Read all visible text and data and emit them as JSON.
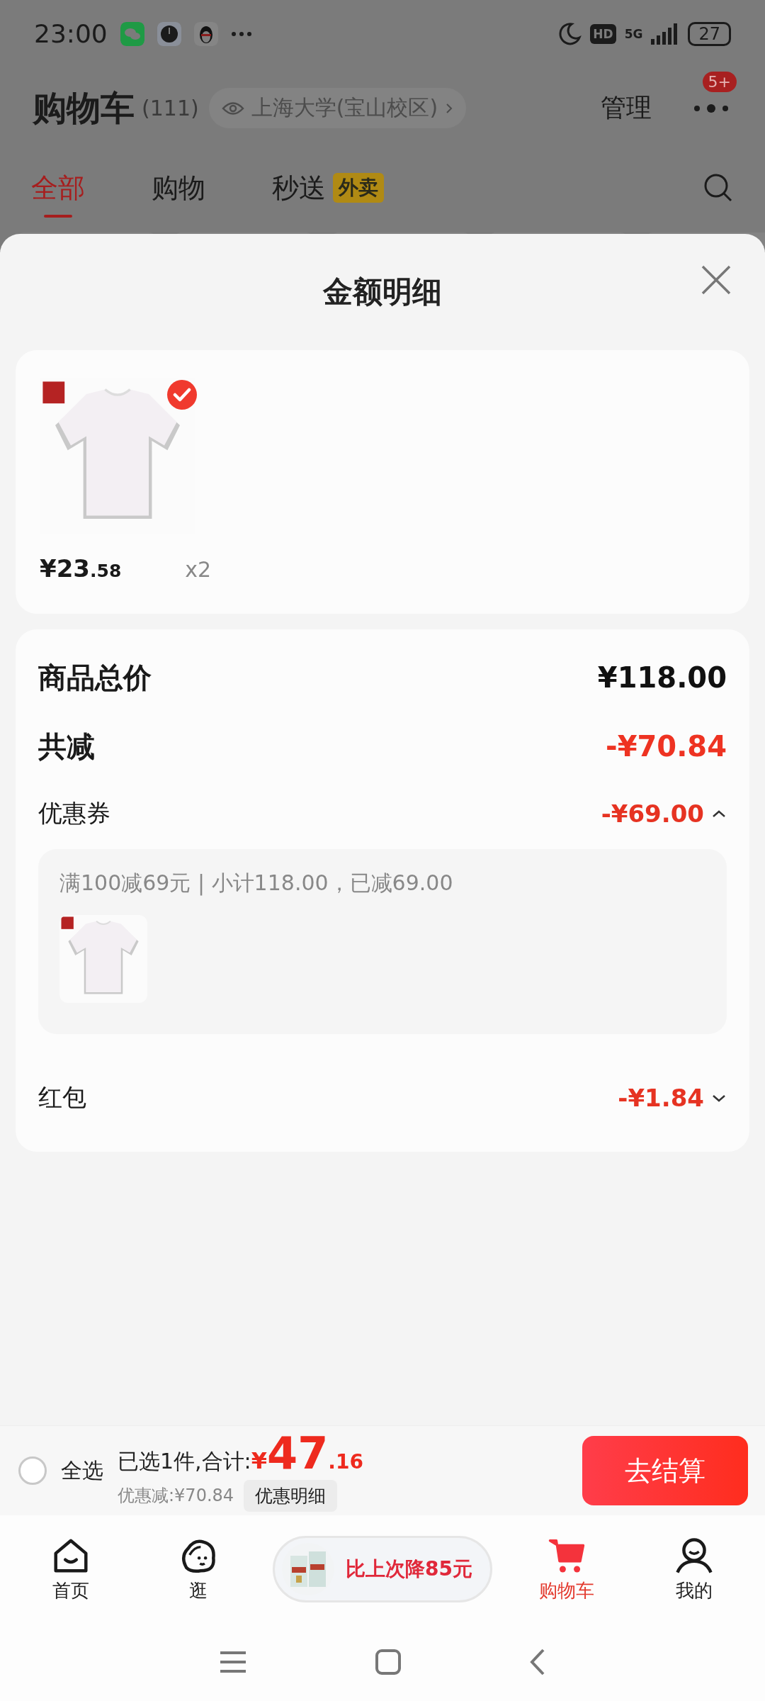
{
  "status_bar": {
    "time": "23:00",
    "hd": "HD",
    "network": "5G",
    "battery": "27"
  },
  "header": {
    "title": "购物车",
    "count": "(111)",
    "location": "上海大学(宝山校区)",
    "manage": "管理",
    "badge": "5+"
  },
  "tabs": [
    {
      "label": "全部",
      "selected": true
    },
    {
      "label": "购物",
      "selected": false
    },
    {
      "label": "秒送",
      "tag": "外卖",
      "selected": false
    }
  ],
  "sheet": {
    "title": "金额明细",
    "products": [
      {
        "price_main": "¥23",
        "price_decimal": ".58",
        "quantity": "x2",
        "selected": true
      }
    ],
    "summary": [
      {
        "kind": "total",
        "label": "商品总价",
        "value": "¥118.00"
      },
      {
        "kind": "reduction",
        "label": "共减",
        "value": "-¥70.84"
      },
      {
        "kind": "detail",
        "label": "优惠券",
        "value": "-¥69.00",
        "expanded": true,
        "note": "满100减69元 | 小计118.00，已减69.00"
      },
      {
        "kind": "detail",
        "label": "红包",
        "value": "-¥1.84",
        "expanded": false
      }
    ]
  },
  "checkout": {
    "select_all": {
      "label": "全选",
      "checked": false
    },
    "summary": "已选1件,合计:",
    "currency": "¥",
    "total_main": "47",
    "total_decimal": ".16",
    "discount": "优惠减:¥70.84",
    "detail_button": "优惠明细",
    "checkout_button": "去结算"
  },
  "nav": {
    "items": [
      {
        "label": "首页",
        "selected": false
      },
      {
        "label": "逛",
        "selected": false
      },
      {
        "label": "购物车",
        "selected": true
      },
      {
        "label": "我的",
        "selected": false
      }
    ],
    "promo": {
      "label": "比上次降85元"
    }
  }
}
